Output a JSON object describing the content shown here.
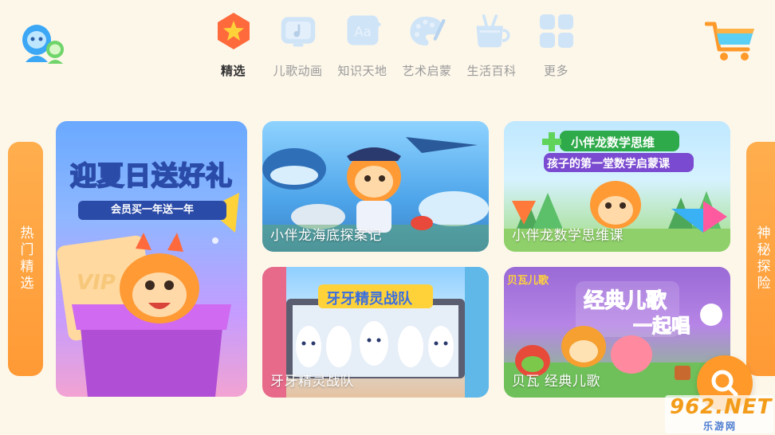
{
  "nav": {
    "items": [
      {
        "label": "精选",
        "icon": "star-icon",
        "active": true
      },
      {
        "label": "儿歌动画",
        "icon": "tv-music-icon",
        "active": false
      },
      {
        "label": "知识天地",
        "icon": "book-aa-icon",
        "active": false
      },
      {
        "label": "艺术启蒙",
        "icon": "palette-icon",
        "active": false
      },
      {
        "label": "生活百科",
        "icon": "cup-icon",
        "active": false
      },
      {
        "label": "更多",
        "icon": "grid-icon",
        "active": false
      }
    ]
  },
  "side": {
    "left_label": "热门精选",
    "right_label": "神秘探险"
  },
  "cards": {
    "promo": {
      "title": "迎夏日送好礼",
      "subtitle": "会员买一年送一年",
      "badge": "VIP"
    },
    "ocean": {
      "title": "小伴龙海底探案记"
    },
    "math": {
      "title": "小伴龙数学思维课",
      "banner1": "小伴龙数学思维",
      "banner2": "孩子的第一堂数学启蒙课"
    },
    "teeth": {
      "title": "牙牙精灵战队",
      "banner": "牙牙精灵战队"
    },
    "songs": {
      "title": "贝瓦 经典儿歌",
      "banner1": "经典儿歌",
      "banner2": "一起唱",
      "logo": "贝瓦儿歌"
    }
  },
  "watermark": {
    "main": "962.NET",
    "sub": "乐游网"
  },
  "colors": {
    "accent": "#ff9a35",
    "background": "#fdf7ea",
    "nav_active": "#333333",
    "nav_inactive": "#9a9a9a"
  }
}
